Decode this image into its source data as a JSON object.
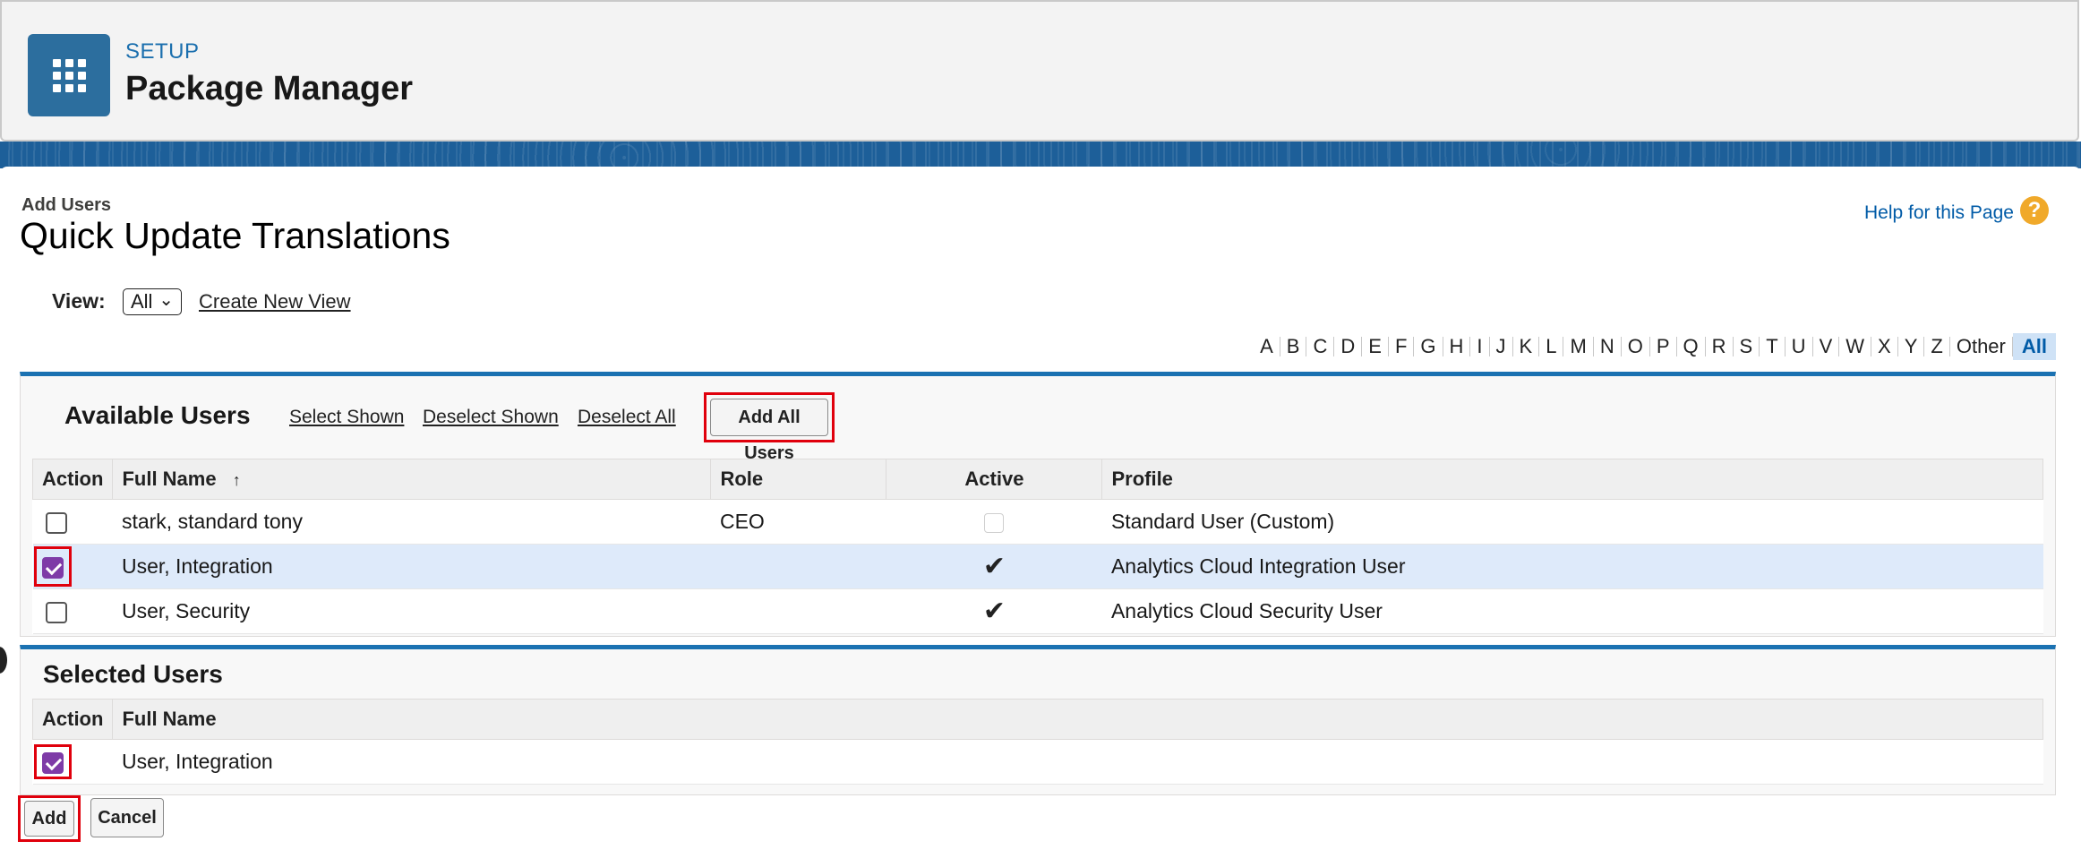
{
  "header": {
    "setup_label": "SETUP",
    "title": "Package Manager",
    "app_icon": "app-launcher-grid-icon"
  },
  "page": {
    "subtitle": "Add Users",
    "title": "Quick Update Translations",
    "help_link": "Help for this Page",
    "help_icon": "?"
  },
  "view": {
    "label": "View:",
    "selected": "All",
    "create_new_view": "Create New View"
  },
  "alphabet": [
    "A",
    "B",
    "C",
    "D",
    "E",
    "F",
    "G",
    "H",
    "I",
    "J",
    "K",
    "L",
    "M",
    "N",
    "O",
    "P",
    "Q",
    "R",
    "S",
    "T",
    "U",
    "V",
    "W",
    "X",
    "Y",
    "Z",
    "Other",
    "All"
  ],
  "alphabet_active": "All",
  "available": {
    "title": "Available Users",
    "select_shown": "Select Shown",
    "deselect_shown": "Deselect Shown",
    "deselect_all": "Deselect All",
    "add_all_users": "Add All Users",
    "columns": {
      "action": "Action",
      "full_name": "Full Name",
      "sort_icon": "↑",
      "role": "Role",
      "active": "Active",
      "profile": "Profile"
    },
    "rows": [
      {
        "full_name": "stark, standard tony",
        "role": "CEO",
        "active": false,
        "profile": "Standard User (Custom)",
        "checked": false
      },
      {
        "full_name": "User, Integration",
        "role": "",
        "active": true,
        "profile": "Analytics Cloud Integration User",
        "checked": true
      },
      {
        "full_name": "User, Security",
        "role": "",
        "active": true,
        "profile": "Analytics Cloud Security User",
        "checked": false
      }
    ]
  },
  "selected": {
    "title": "Selected Users",
    "columns": {
      "action": "Action",
      "full_name": "Full Name"
    },
    "rows": [
      {
        "full_name": "User, Integration",
        "checked": true
      }
    ]
  },
  "buttons": {
    "add": "Add",
    "cancel": "Cancel"
  },
  "colors": {
    "brand_blue": "#1b72b2",
    "checkbox_purple": "#7e3ba7",
    "highlight_red": "#e0000c",
    "link_blue": "#015ba7"
  }
}
